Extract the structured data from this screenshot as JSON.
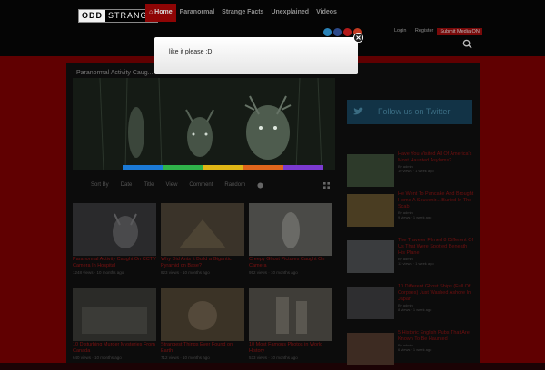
{
  "header": {
    "logo_part1": "ODD",
    "logo_part2": "STRANGE",
    "nav": [
      {
        "label": "⌂ Home",
        "active": true
      },
      {
        "label": "Paranormal",
        "active": false
      },
      {
        "label": "Strange Facts",
        "active": false
      },
      {
        "label": "Unexplained",
        "active": false
      },
      {
        "label": "Videos",
        "active": false
      }
    ],
    "login": "Login",
    "sep": "|",
    "register": "Register",
    "submit": "Submit Media ON",
    "social": [
      {
        "name": "twitter-icon",
        "color": "#2a83b8"
      },
      {
        "name": "facebook-icon",
        "color": "#2d4a8a"
      },
      {
        "name": "pinterest-icon",
        "color": "#b21a1a"
      },
      {
        "name": "google-plus-icon",
        "color": "#c23b22"
      }
    ]
  },
  "popup": {
    "message": "like it please :D"
  },
  "hero": {
    "title": "Paranormal Activity Caug...",
    "stripe_colors": [
      "#1b7ad6",
      "#2fb34a",
      "#e0b716",
      "#e0661c",
      "#7b3ad0"
    ]
  },
  "sort": {
    "labels": [
      "Sort By",
      "Date",
      "Title",
      "View",
      "Comment",
      "Random"
    ]
  },
  "cards": [
    {
      "title": "Paranormal Activity Caught On CCTV Camera In Hospital",
      "meta": "1248 views · 10 months ago",
      "color": "#2a2a2c"
    },
    {
      "title": "Why Did Ants It Build a Gigantic Pyramid on Base?",
      "meta": "823 views · 10 months ago",
      "color": "#3a3329"
    },
    {
      "title": "Creepy Ghost Pictures Caught On Camera",
      "meta": "952 views · 10 months ago",
      "color": "#4a4a47"
    },
    {
      "title": "10 Disturbing Murder Mysteries From Canada",
      "meta": "640 views · 10 months ago",
      "color": "#2b2b28"
    },
    {
      "title": "Strangest Things Ever Found on Earth",
      "meta": "712 views · 10 months ago",
      "color": "#3b3326"
    },
    {
      "title": "10 Most Famous Photos in World History",
      "meta": "533 views · 10 months ago",
      "color": "#3f3d38"
    }
  ],
  "sidebar": {
    "follow_text": "Follow us on Twitter",
    "items": [
      {
        "title": "Have You Visited All Of America's Most Haunted Asylums?",
        "meta1": "By admin",
        "meta2": "10 views · 1 week ago",
        "color": "#2d3a2a"
      },
      {
        "title": "He Went To Pancake And Brought Home A Souvenir... Buried In The Scab",
        "meta1": "By admin",
        "meta2": "9 views · 1 week ago",
        "color": "#4a3d22"
      },
      {
        "title": "The Traveler Filmed 8 Different Of Us That Were Spotted Beneath His Plane",
        "meta1": "By admin",
        "meta2": "12 views · 1 week ago",
        "color": "#3a3c3e"
      },
      {
        "title": "10 Different Ghost Ships (Full Of Corpses) Just Washed Ashore In Japan",
        "meta1": "By admin",
        "meta2": "8 views · 1 week ago",
        "color": "#2e2e30"
      },
      {
        "title": "5 Historic English Pubs That Are Known To Be Haunted",
        "meta1": "By admin",
        "meta2": "6 views · 1 week ago",
        "color": "#3d2b22"
      }
    ]
  }
}
